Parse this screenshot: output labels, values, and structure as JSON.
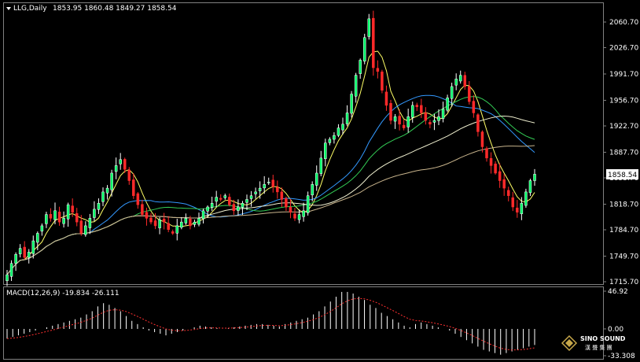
{
  "header": {
    "symbol": "LLG,Daily",
    "ohlc": "1853.95 1860.48 1849.27 1858.54"
  },
  "price_axis": {
    "ticks": [
      "2060.70",
      "2026.70",
      "1991.70",
      "1956.70",
      "1922.70",
      "1887.70",
      "1853.70",
      "1818.70",
      "1784.70",
      "1749.70",
      "1715.70"
    ],
    "current_price": "1858.54"
  },
  "macd": {
    "label": "MACD(12,26,9) -19.834 -26.111",
    "ticks": [
      "46.92",
      "0.00",
      "-33.308"
    ]
  },
  "logo": {
    "name": "SINO SOUND",
    "sub": "漢 聲 集 團"
  },
  "colors": {
    "background": "#000000",
    "bull": "#ffffff",
    "bull_fill": "#00ff66",
    "bear": "#ff2a2a",
    "grid": "#808080",
    "ma_fast": "#ffff66",
    "ma_mid": "#3399ff",
    "ma_green": "#33cc55",
    "ma_white": "#f0f0d0",
    "ma_slow": "#c8b48c",
    "macd_hist": "#ffffff",
    "macd_signal": "#ff3030"
  },
  "chart_data": {
    "type": "candlestick",
    "symbol": "LLG",
    "timeframe": "Daily",
    "ylim": [
      1715.7,
      2075.0
    ],
    "close_series": [
      1725,
      1740,
      1752,
      1760,
      1748,
      1755,
      1770,
      1780,
      1790,
      1805,
      1800,
      1810,
      1795,
      1800,
      1818,
      1808,
      1795,
      1780,
      1790,
      1800,
      1812,
      1820,
      1835,
      1840,
      1860,
      1870,
      1878,
      1865,
      1850,
      1830,
      1818,
      1805,
      1800,
      1795,
      1790,
      1798,
      1795,
      1785,
      1780,
      1790,
      1795,
      1800,
      1790,
      1795,
      1800,
      1810,
      1815,
      1820,
      1828,
      1825,
      1830,
      1818,
      1810,
      1815,
      1820,
      1825,
      1830,
      1835,
      1840,
      1845,
      1848,
      1842,
      1835,
      1825,
      1815,
      1808,
      1800,
      1805,
      1810,
      1830,
      1845,
      1860,
      1880,
      1900,
      1905,
      1910,
      1920,
      1925,
      1940,
      1965,
      1990,
      2010,
      2040,
      2065,
      2000,
      1995,
      1970,
      1950,
      1930,
      1935,
      1925,
      1920,
      1935,
      1950,
      1948,
      1940,
      1930,
      1925,
      1930,
      1935,
      1945,
      1960,
      1975,
      1985,
      1990,
      1975,
      1955,
      1940,
      1915,
      1895,
      1880,
      1870,
      1860,
      1850,
      1840,
      1830,
      1815,
      1808,
      1820,
      1835,
      1850,
      1858.54
    ],
    "macd_hist": [
      -12,
      -10,
      -8,
      -6,
      -4,
      -2,
      0,
      2,
      4,
      6,
      8,
      10,
      12,
      14,
      18,
      22,
      28,
      32,
      30,
      26,
      22,
      16,
      10,
      6,
      2,
      -2,
      -4,
      -6,
      -8,
      -6,
      -4,
      -2,
      0,
      2,
      4,
      3,
      2,
      1,
      0,
      1,
      2,
      3,
      4,
      5,
      6,
      6,
      5,
      4,
      3,
      6,
      8,
      10,
      12,
      14,
      18,
      22,
      28,
      34,
      40,
      46,
      46,
      44,
      40,
      36,
      30,
      26,
      20,
      16,
      12,
      8,
      4,
      2,
      6,
      8,
      6,
      4,
      2,
      0,
      -2,
      -6,
      -10,
      -14,
      -18,
      -22,
      -26,
      -28,
      -30,
      -32,
      -30,
      -28,
      -26,
      -24,
      -22,
      -20
    ],
    "macd_value": -19.834,
    "signal_value": -26.111,
    "macd_ylim": [
      -33.308,
      46.92
    ]
  }
}
